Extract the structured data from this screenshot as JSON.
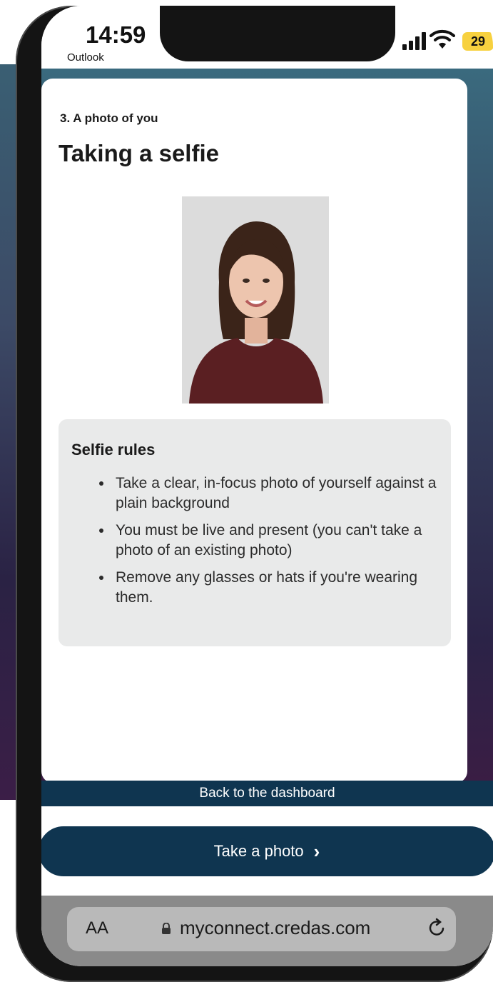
{
  "status_bar": {
    "time": "14:59",
    "back_app": "Outlook",
    "battery": "29"
  },
  "page": {
    "step": "3. A photo of you",
    "title": "Taking a selfie"
  },
  "rules": {
    "heading": "Selfie rules",
    "items": [
      "Take a clear, in-focus photo of yourself against a plain background",
      "You must be live and present (you can't take a photo of an existing photo)",
      "Remove any glasses or hats if you're wearing them."
    ]
  },
  "actions": {
    "back_to_dashboard": "Back to the dashboard",
    "take_photo": "Take a photo",
    "take_photo_chevron": "›"
  },
  "browser": {
    "text_size": "AA",
    "url": "myconnect.credas.com"
  },
  "colors": {
    "primary": "#0f3550",
    "rules_bg": "#e9eaea",
    "battery": "#f7d13f"
  }
}
